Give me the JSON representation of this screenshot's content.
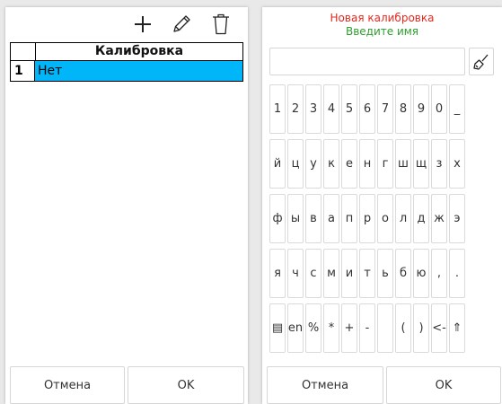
{
  "left": {
    "toolbar": {
      "add_icon": "plus-icon",
      "edit_icon": "pencil-icon",
      "delete_icon": "trash-icon"
    },
    "table": {
      "column_header": "Калибровка",
      "rows": [
        {
          "num": "1",
          "value": "Нет"
        }
      ]
    },
    "buttons": {
      "cancel": "Отмена",
      "ok": "OK"
    }
  },
  "right": {
    "title": "Новая калибровка",
    "subtitle": "Введите имя",
    "name_value": "",
    "clear_icon": "broom-icon",
    "keyboard": {
      "rows": [
        [
          "1",
          "2",
          "3",
          "4",
          "5",
          "6",
          "7",
          "8",
          "9",
          "0",
          "_"
        ],
        [
          "й",
          "ц",
          "у",
          "к",
          "е",
          "н",
          "г",
          "ш",
          "щ",
          "з",
          "х"
        ],
        [
          "ф",
          "ы",
          "в",
          "а",
          "п",
          "р",
          "о",
          "л",
          "д",
          "ж",
          "э"
        ],
        [
          "я",
          "ч",
          "с",
          "м",
          "и",
          "т",
          "ь",
          "б",
          "ю",
          ",",
          "."
        ],
        [
          "▤",
          "en",
          "%",
          "*",
          "+",
          "-",
          "",
          "(",
          ")",
          "<-",
          "⇑"
        ]
      ]
    },
    "buttons": {
      "cancel": "Отмена",
      "ok": "OK"
    }
  },
  "colors": {
    "selected_row": "#00b6f9",
    "title": "#e8281e",
    "subtitle": "#2e9e2e"
  }
}
